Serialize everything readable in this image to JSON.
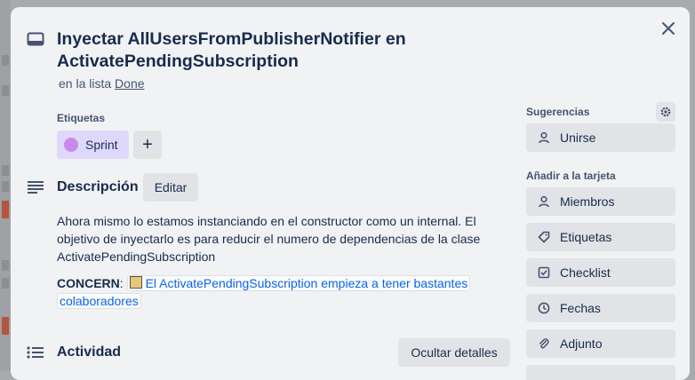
{
  "card": {
    "title": "Inyectar AllUsersFromPublisherNotifier en ActivatePendingSubscription",
    "list_prefix": "en la lista",
    "list_name": "Done"
  },
  "labels": {
    "heading": "Etiquetas",
    "items": [
      {
        "name": "Sprint",
        "color": "#c88ae8"
      }
    ],
    "add_symbol": "+"
  },
  "description": {
    "heading": "Descripción",
    "edit_label": "Editar",
    "text": "Ahora mismo lo estamos instanciando en el constructor como un internal. El objetivo de inyectarlo es para reducir el numero de dependencias de la clase ActivatePendingSubscription",
    "concern_label": "CONCERN",
    "concern_sep": ":",
    "concern_link": "El ActivatePendingSubscription empieza a tener bastantes colaboradores"
  },
  "activity": {
    "heading": "Actividad",
    "toggle_label": "Ocultar detalles"
  },
  "sidebar": {
    "suggestions_heading": "Sugerencias",
    "join_label": "Unirse",
    "add_heading": "Añadir a la tarjeta",
    "items": [
      {
        "label": "Miembros",
        "icon": "person-icon"
      },
      {
        "label": "Etiquetas",
        "icon": "tag-icon"
      },
      {
        "label": "Checklist",
        "icon": "checkbox-icon"
      },
      {
        "label": "Fechas",
        "icon": "clock-icon"
      },
      {
        "label": "Adjunto",
        "icon": "paperclip-icon"
      }
    ]
  },
  "colors": {
    "modal_bg": "#f1f2f4",
    "button_bg": "#e2e3e6",
    "label_bg": "#dfd8fd",
    "link": "#0c66e4"
  }
}
